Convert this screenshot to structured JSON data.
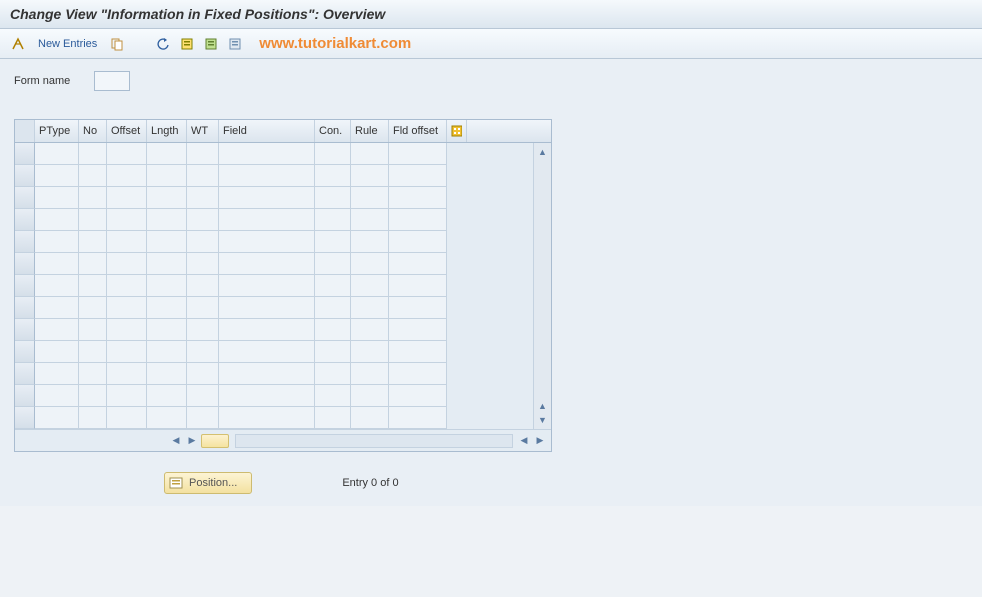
{
  "header": {
    "title": "Change View \"Information in Fixed Positions\": Overview"
  },
  "toolbar": {
    "new_entries_label": "New Entries"
  },
  "watermark": "www.tutorialkart.com",
  "form": {
    "form_name_label": "Form name",
    "form_name_value": ""
  },
  "grid": {
    "columns": [
      "PType",
      "No",
      "Offset",
      "Lngth",
      "WT",
      "Field",
      "Con.",
      "Rule",
      "Fld offset"
    ],
    "row_count": 13
  },
  "footer": {
    "position_button_label": "Position...",
    "entry_text": "Entry 0 of 0"
  }
}
